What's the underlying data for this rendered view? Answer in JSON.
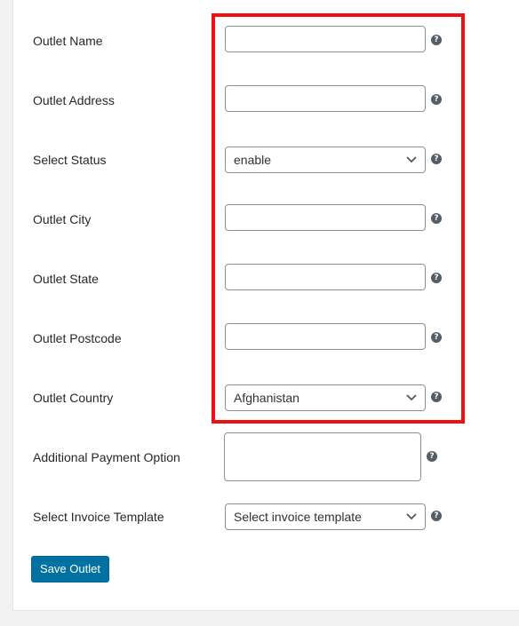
{
  "form": {
    "fields": {
      "outlet_name": {
        "label": "Outlet Name",
        "value": ""
      },
      "outlet_address": {
        "label": "Outlet Address",
        "value": ""
      },
      "select_status": {
        "label": "Select Status",
        "value": "enable"
      },
      "outlet_city": {
        "label": "Outlet City",
        "value": ""
      },
      "outlet_state": {
        "label": "Outlet State",
        "value": ""
      },
      "outlet_postcode": {
        "label": "Outlet Postcode",
        "value": ""
      },
      "outlet_country": {
        "label": "Outlet Country",
        "value": "Afghanistan"
      },
      "additional_payment_option": {
        "label": "Additional Payment Option",
        "value": ""
      },
      "select_invoice_template": {
        "label": "Select Invoice Template",
        "value": "Select invoice template"
      }
    },
    "help_icon_glyph": "?",
    "submit_label": "Save Outlet"
  },
  "colors": {
    "highlight_border": "#ee1111",
    "button_bg": "#0071a1",
    "page_bg": "#f1f1f1"
  },
  "icons": {
    "help": "question-circle-icon",
    "dropdown": "chevron-down-icon"
  }
}
